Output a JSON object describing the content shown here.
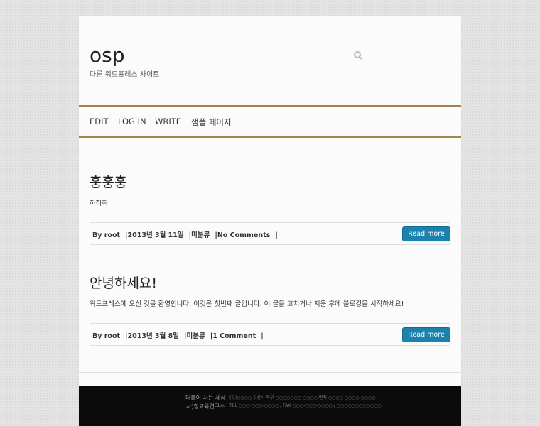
{
  "site": {
    "title": "osp",
    "tagline": "다른 워드프레스 사이트"
  },
  "nav": {
    "items": [
      "EDIT",
      "LOG IN",
      "WRITE",
      "샘플 페이지"
    ]
  },
  "posts": [
    {
      "title": "훙훙훙",
      "body": "하하하",
      "meta": {
        "by": "By",
        "author": "root",
        "date": "2013년 3월 11일",
        "category": "미분류",
        "comments": "No Comments"
      },
      "read_more": "Read more"
    },
    {
      "title": "안녕하세요!",
      "body": "워드프레스에 오신 것을 환영합니다. 이것은 첫번째 글입니다. 이 글을 고치거나 지운 후에 블로깅을 시작하세요!",
      "meta": {
        "by": "By",
        "author": "root",
        "date": "2013년 3월 8일",
        "category": "미분류",
        "comments": "1 Comment"
      },
      "read_more": "Read more"
    }
  ],
  "footer": {
    "logo_line1": "더불어 사는 세상",
    "logo_line2": "사)참교육연구소",
    "info_line1": "(우)○○○○ 부산시 북구 ○○○○○○○ ○○○○ 번지 ○○○○ ○○○○ ○○○○",
    "info_line2": "TEL ○○○-○○○-○○○○ / FAX ○○○-○○○-○○○○ / ○○○○○○○○○○○○"
  },
  "colors": {
    "nav_border": "#a8824b",
    "button": "#1b82ad",
    "footer_bg": "#0b0b0b"
  }
}
